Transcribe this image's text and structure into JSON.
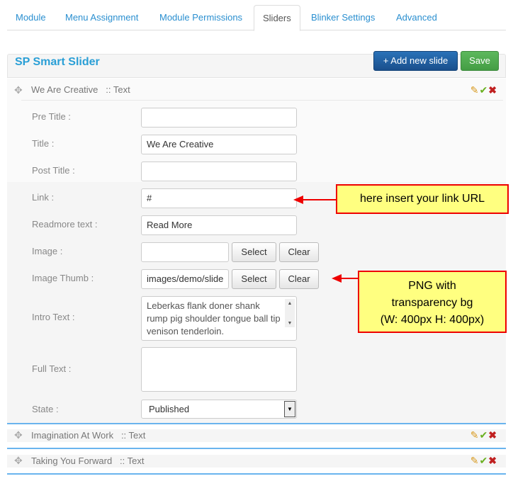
{
  "tabs": [
    "Module",
    "Menu Assignment",
    "Module Permissions",
    "Sliders",
    "Blinker Settings",
    "Advanced"
  ],
  "panel": {
    "title": "SP Smart Slider",
    "add_label": "+ Add new slide",
    "save_label": "Save"
  },
  "slides": [
    {
      "title": "We Are Creative",
      "type": ":: Text"
    },
    {
      "title": "Imagination At Work",
      "type": ":: Text"
    },
    {
      "title": "Taking You Forward",
      "type": ":: Text"
    }
  ],
  "form": {
    "pre_title_label": "Pre Title :",
    "pre_title": "",
    "title_label": "Title :",
    "title": "We Are Creative",
    "post_title_label": "Post Title :",
    "post_title": "",
    "link_label": "Link :",
    "link": "#",
    "readmore_label": "Readmore text :",
    "readmore": "Read More",
    "image_label": "Image :",
    "image": "",
    "thumb_label": "Image Thumb :",
    "thumb": "images/demo/slide",
    "select_label": "Select",
    "clear_label": "Clear",
    "intro_label": "Intro Text :",
    "intro": "Leberkas flank doner shank rump pig shoulder tongue ball tip venison tenderloin.",
    "full_label": "Full Text :",
    "full": "",
    "state_label": "State :",
    "state": "Published"
  },
  "callouts": {
    "link": "here insert your link URL",
    "thumb_1": "PNG with",
    "thumb_2": "transparency bg",
    "thumb_3": "(W: 400px H: 400px)"
  },
  "icons": {
    "move": "move-icon",
    "edit": "pencil-icon",
    "publish": "check-icon",
    "delete": "close-icon"
  }
}
